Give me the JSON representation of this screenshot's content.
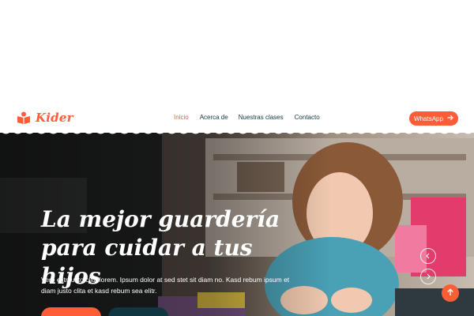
{
  "brand": {
    "name": "Kider"
  },
  "nav": {
    "items": [
      {
        "label": "Inicio",
        "active": true
      },
      {
        "label": "Acerca de",
        "active": false
      },
      {
        "label": "Nuestras clases",
        "active": false
      },
      {
        "label": "Contacto",
        "active": false
      }
    ],
    "cta_label": "WhatsApp"
  },
  "hero": {
    "title": "La mejor guardería para cuidar a tus hijos",
    "text": "Vero elitr justo clita lorem. Ipsum dolor at sed stet sit diam no. Kasd rebum ipsum et diam justo clita et kasd rebum sea elitr."
  },
  "icons": {
    "brand": "book-icon",
    "cta": "arrow-right-icon",
    "prev": "chevron-left-icon",
    "next": "chevron-right-icon",
    "back_to_top": "arrow-up-icon"
  },
  "colors": {
    "primary": "#fe5d37",
    "dark": "#103741",
    "white": "#ffffff"
  }
}
